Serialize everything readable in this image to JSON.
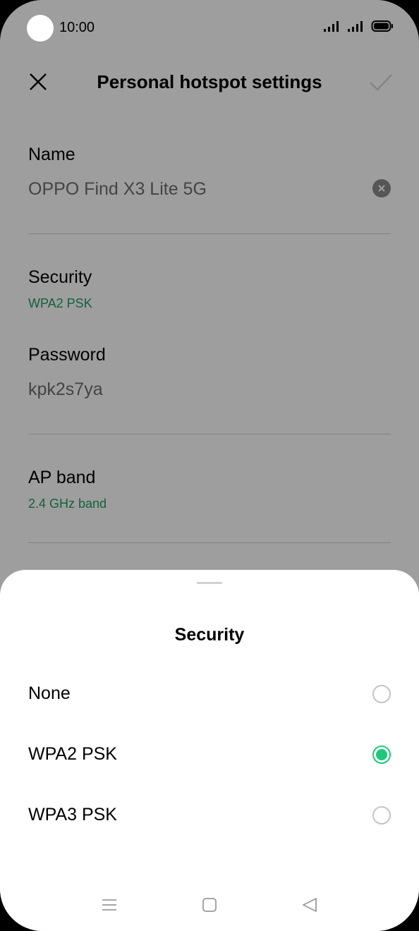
{
  "status_bar": {
    "time": "10:00",
    "icons": [
      "signal-icon",
      "signal-icon",
      "battery-icon"
    ]
  },
  "header": {
    "title": "Personal hotspot settings",
    "close_icon": "close-icon",
    "confirm_icon": "check-icon"
  },
  "fields": {
    "name": {
      "label": "Name",
      "value": "OPPO Find X3 Lite 5G"
    },
    "security": {
      "label": "Security",
      "value": "WPA2 PSK"
    },
    "password": {
      "label": "Password",
      "value": "kpk2s7ya"
    },
    "ap_band": {
      "label": "AP band",
      "value": "2.4 GHz band"
    }
  },
  "sheet": {
    "title": "Security",
    "options": [
      {
        "label": "None",
        "selected": false
      },
      {
        "label": "WPA2 PSK",
        "selected": true
      },
      {
        "label": "WPA3 PSK",
        "selected": false
      }
    ]
  },
  "navigation": [
    "menu-icon",
    "home-icon",
    "back-icon"
  ],
  "colors": {
    "accent": "#1fc77a",
    "subtitle_green": "#1f9d62"
  }
}
